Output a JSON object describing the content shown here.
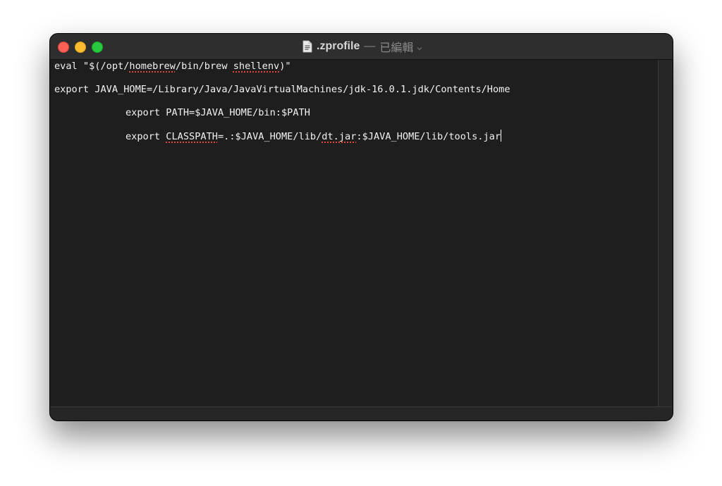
{
  "window": {
    "title_filename": ".zprofile",
    "title_separator": "—",
    "title_status": "已編輯",
    "icons": {
      "document": "document-icon",
      "chevron": "chevron-down-icon"
    },
    "traffic_lights": {
      "close_color": "#fe5f57",
      "minimize_color": "#febc2e",
      "zoom_color": "#28c840"
    }
  },
  "editor": {
    "lines": [
      {
        "segments": [
          {
            "text": "eval \"$(/opt/",
            "spell": false
          },
          {
            "text": "homebrew",
            "spell": true
          },
          {
            "text": "/bin/brew ",
            "spell": false
          },
          {
            "text": "shellenv",
            "spell": true
          },
          {
            "text": ")\"",
            "spell": false
          }
        ]
      },
      {
        "segments": [
          {
            "text": "export JAVA_HOME=/Library/Java/JavaVirtualMachines/jdk-16.0.1.jdk/Contents/Home",
            "spell": false
          }
        ]
      },
      {
        "segments": [
          {
            "text": "export PATH=$JAVA_HOME/bin:$PATH",
            "spell": false
          }
        ]
      },
      {
        "segments": [
          {
            "text": "export ",
            "spell": false
          },
          {
            "text": "CLASSPATH",
            "spell": true
          },
          {
            "text": "=.:$JAVA_HOME/lib/",
            "spell": false
          },
          {
            "text": "dt.jar",
            "spell": true
          },
          {
            "text": ":$JAVA_HOME/lib/tools.jar",
            "spell": false
          }
        ]
      }
    ],
    "background": "#1e1e1e",
    "text_color": "#f2f2f2",
    "spellcheck_color": "#e0443e"
  }
}
